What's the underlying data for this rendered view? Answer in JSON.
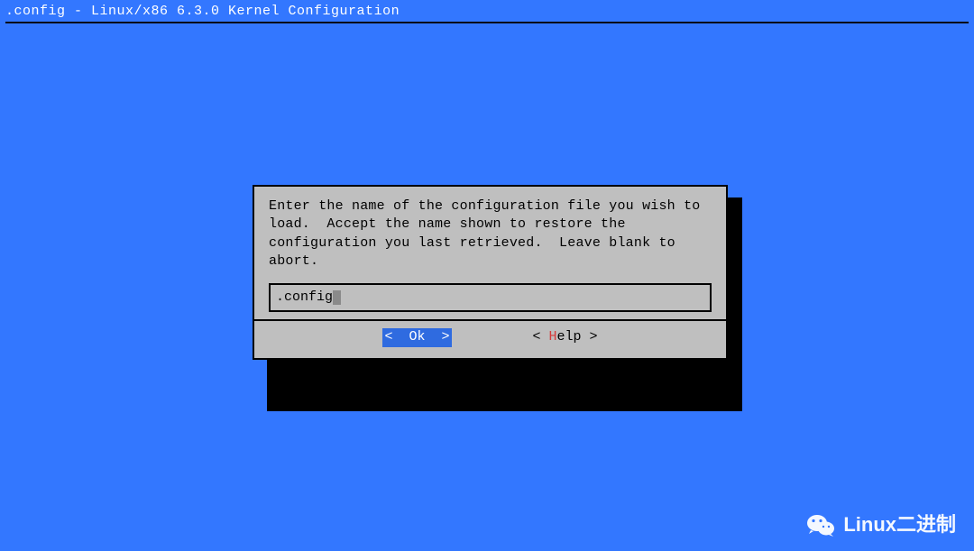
{
  "title": ".config - Linux/x86 6.3.0 Kernel Configuration",
  "dialog": {
    "prompt": "Enter the name of the configuration file you wish to load.  Accept the name shown to restore the configuration you last retrieved.  Leave blank to abort.",
    "input_value": ".config",
    "buttons": {
      "ok": {
        "open": "<  ",
        "hot": "O",
        "rest": "k  >",
        "selected": true
      },
      "help": {
        "open": "< ",
        "hot": "H",
        "rest": "elp >",
        "selected": false
      }
    }
  },
  "watermark": {
    "text": "Linux二进制"
  }
}
